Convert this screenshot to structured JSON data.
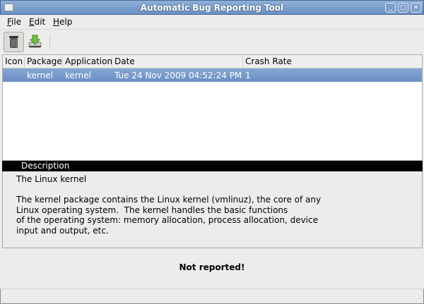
{
  "window": {
    "title": "Automatic Bug Reporting Tool"
  },
  "menu": [
    {
      "label": "File",
      "key": "F",
      "rest": "ile"
    },
    {
      "label": "Edit",
      "key": "E",
      "rest": "dit"
    },
    {
      "label": "Help",
      "key": "H",
      "rest": "elp"
    }
  ],
  "toolbar": {
    "buttons": [
      {
        "icon": "trash-icon",
        "label": "Delete"
      },
      {
        "icon": "download-icon",
        "label": "Report"
      }
    ]
  },
  "table": {
    "columns": [
      "Icon",
      "Package",
      "Application",
      "Date",
      "Crash Rate"
    ],
    "rows": [
      {
        "icon": "",
        "package": "kernel",
        "application": "kernel",
        "date": "Tue 24 Nov 2009 04:52:24 PM",
        "crash_rate": "1",
        "selected": true
      }
    ]
  },
  "description": {
    "header": "Description",
    "text": "The Linux kernel\n\nThe kernel package contains the Linux kernel (vmlinuz), the core of any\nLinux operating system.  The kernel handles the basic functions\nof the operating system: memory allocation, process allocation, device\ninput and output, etc."
  },
  "status": "Not reported!"
}
